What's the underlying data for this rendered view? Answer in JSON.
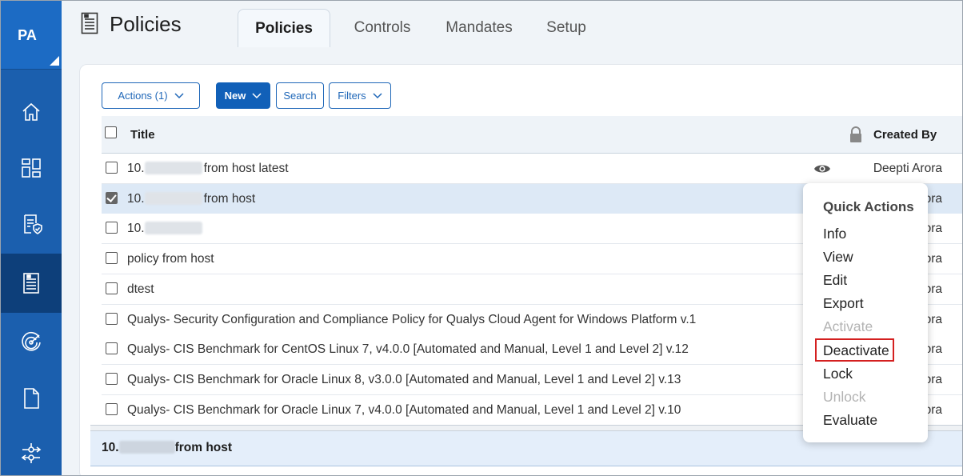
{
  "sidebar": {
    "app_label": "PA",
    "items": [
      {
        "icon": "home-icon"
      },
      {
        "icon": "dashboard-icon"
      },
      {
        "icon": "compliance-document-icon"
      },
      {
        "icon": "policies-icon",
        "active": true
      },
      {
        "icon": "scan-radar-icon"
      },
      {
        "icon": "file-icon"
      },
      {
        "icon": "connector-icon"
      }
    ]
  },
  "header": {
    "title": "Policies",
    "tabs": [
      {
        "label": "Policies",
        "active": true
      },
      {
        "label": "Controls"
      },
      {
        "label": "Mandates"
      },
      {
        "label": "Setup"
      }
    ]
  },
  "toolbar": {
    "actions_label": "Actions (1)",
    "new_label": "New",
    "search_label": "Search",
    "filters_label": "Filters"
  },
  "table": {
    "columns": {
      "title": "Title",
      "created_by": "Created By"
    },
    "rows": [
      {
        "prefix": "10.",
        "suffix": "from host latest",
        "redacted": true,
        "created_by": "Deepti Arora",
        "checked": false
      },
      {
        "prefix": "10.",
        "suffix": "from host",
        "redacted": true,
        "created_by": "ora",
        "checked": true
      },
      {
        "prefix": "10.",
        "suffix": "",
        "redacted": true,
        "created_by": "ora",
        "checked": false
      },
      {
        "prefix": "policy from host",
        "suffix": "",
        "redacted": false,
        "created_by": "ora",
        "checked": false
      },
      {
        "prefix": "dtest",
        "suffix": "",
        "redacted": false,
        "created_by": "ora",
        "checked": false
      },
      {
        "prefix": "Qualys- Security Configuration and Compliance Policy for Qualys Cloud Agent for Windows Platform v.1",
        "suffix": "",
        "redacted": false,
        "created_by": "ora",
        "checked": false
      },
      {
        "prefix": "Qualys- CIS Benchmark for CentOS Linux 7, v4.0.0 [Automated and Manual, Level 1 and Level 2] v.12",
        "suffix": "",
        "redacted": false,
        "created_by": "ora",
        "checked": false
      },
      {
        "prefix": "Qualys- CIS Benchmark for Oracle Linux 8, v3.0.0 [Automated and Manual, Level 1 and Level 2] v.13",
        "suffix": "",
        "redacted": false,
        "created_by": "ora",
        "checked": false
      },
      {
        "prefix": "Qualys- CIS Benchmark for Oracle Linux 7, v4.0.0 [Automated and Manual, Level 1 and Level 2] v.10",
        "suffix": "",
        "redacted": false,
        "created_by": "ora",
        "checked": false
      }
    ]
  },
  "detail": {
    "prefix": "10.",
    "suffix": "from host"
  },
  "quick_actions": {
    "title": "Quick Actions",
    "items": [
      {
        "label": "Info",
        "disabled": false
      },
      {
        "label": "View",
        "disabled": false
      },
      {
        "label": "Edit",
        "disabled": false
      },
      {
        "label": "Export",
        "disabled": false
      },
      {
        "label": "Activate",
        "disabled": true
      },
      {
        "label": "Deactivate",
        "disabled": false,
        "highlighted": true
      },
      {
        "label": "Lock",
        "disabled": false
      },
      {
        "label": "Unlock",
        "disabled": true
      },
      {
        "label": "Evaluate",
        "disabled": false
      }
    ]
  },
  "colors": {
    "sidebar": "#1b5fae",
    "sidebar_active": "#0d3f7a",
    "primary_button": "#1160b8",
    "selected_row": "#dde9f6",
    "highlight_border": "#d42020"
  }
}
